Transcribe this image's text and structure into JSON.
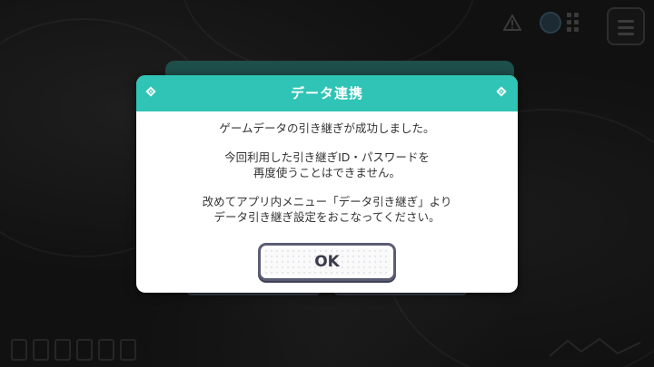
{
  "dialog": {
    "title": "データ連携",
    "body": {
      "line1": "ゲームデータの引き継ぎが成功しました。",
      "line2": "今回利用した引き継ぎID・パスワードを",
      "line3": "再度使うことはできません。",
      "line4": "改めてアプリ内メニュー「データ引き継ぎ」より",
      "line5": "データ引き継ぎ設定をおこなってください。"
    },
    "ok_label": "OK"
  },
  "colors": {
    "header": "#2fc4b5",
    "ok_border": "#5b5e73",
    "backdrop": "#111111"
  },
  "icons": {
    "warning": "warning-icon",
    "menu": "hamburger-menu-icon",
    "diamond": "diamond-ornament-icon"
  }
}
